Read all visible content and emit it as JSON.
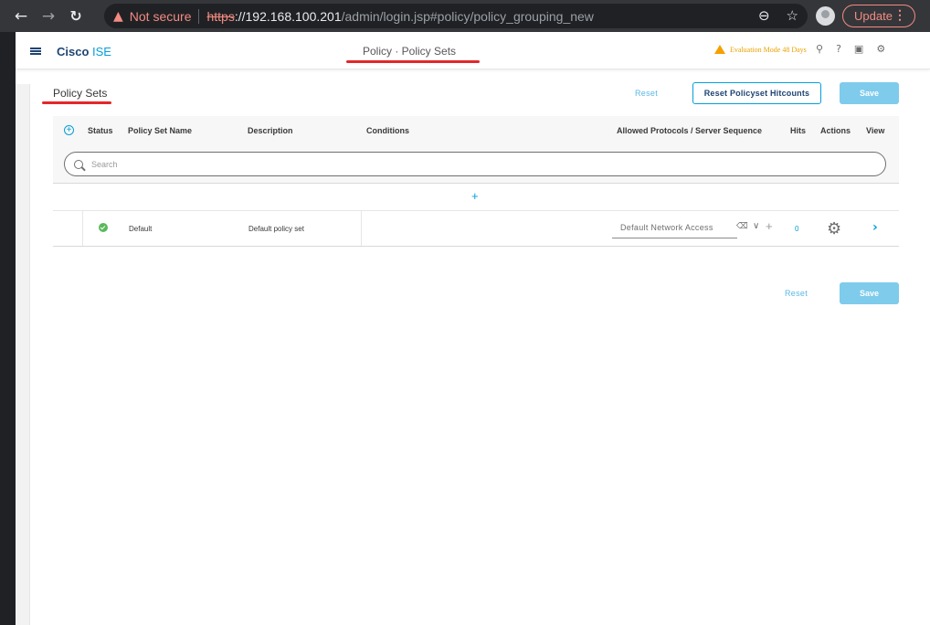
{
  "browser": {
    "security_label": "Not secure",
    "url_scheme": "https",
    "url_host": "://192.168.100.201",
    "url_path": "/admin/login.jsp#policy/policy_grouping_new",
    "update_label": "Update"
  },
  "app": {
    "brand_bold": "Cisco",
    "brand_rest": " ISE",
    "page_title": "Policy · Policy Sets",
    "eval_notice": "Evaluation Mode 48 Days"
  },
  "section": {
    "title": "Policy Sets",
    "reset_label": "Reset",
    "reset_hitcounts_label": "Reset Policyset Hitcounts",
    "save_label": "Save"
  },
  "table": {
    "columns": {
      "status": "Status",
      "name": "Policy Set Name",
      "description": "Description",
      "conditions": "Conditions",
      "protocols": "Allowed Protocols / Server Sequence",
      "hits": "Hits",
      "actions": "Actions",
      "view": "View"
    },
    "search_placeholder": "Search",
    "rows": [
      {
        "name": "Default",
        "description": "Default policy set",
        "protocol": "Default Network Access",
        "hits": "0"
      }
    ]
  },
  "footer": {
    "reset_label": "Reset",
    "save_label": "Save"
  },
  "colors": {
    "accent": "#049fd9",
    "brand_dark": "#1e4471",
    "status_ok": "#5cb85c",
    "warning": "#f5a000",
    "annotation_red": "#e4262a"
  }
}
